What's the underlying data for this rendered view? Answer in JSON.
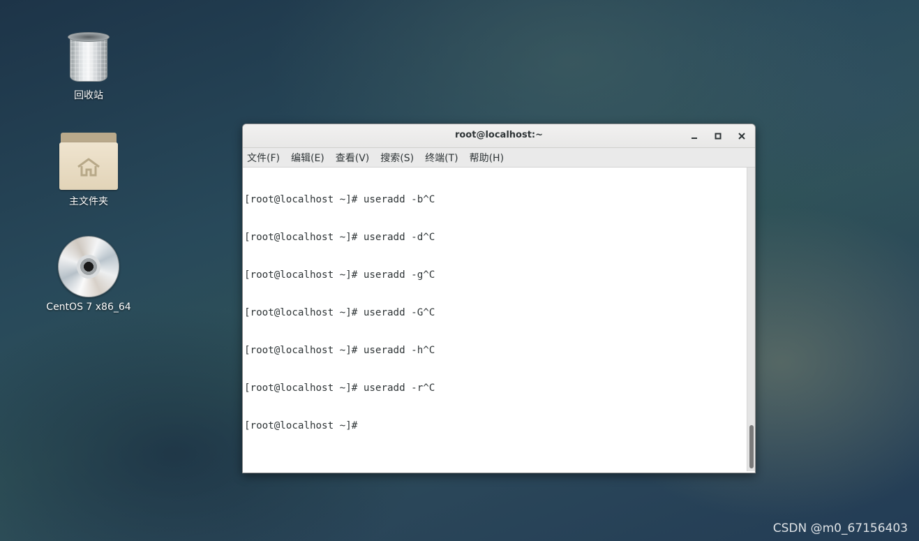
{
  "desktop": {
    "icons": [
      {
        "label": "回收站",
        "icon": "trash-icon"
      },
      {
        "label": "主文件夹",
        "icon": "home-folder-icon"
      },
      {
        "label": "CentOS 7 x86_64",
        "icon": "disc-icon"
      }
    ]
  },
  "terminal": {
    "title": "root@localhost:~",
    "window_buttons": {
      "minimize": "‗",
      "maximize": "□",
      "close": "✕"
    },
    "menu": [
      "文件(F)",
      "编辑(E)",
      "查看(V)",
      "搜索(S)",
      "终端(T)",
      "帮助(H)"
    ],
    "lines": [
      "[root@localhost ~]# useradd -b^C",
      "[root@localhost ~]# useradd -d^C",
      "[root@localhost ~]# useradd -g^C",
      "[root@localhost ~]# useradd -G^C",
      "[root@localhost ~]# useradd -h^C",
      "[root@localhost ~]# useradd -r^C",
      "[root@localhost ~]#"
    ],
    "scroll_position": 1.0
  },
  "watermark": "CSDN @m0_67156403",
  "colors": {
    "desktop_bg": "#28495a",
    "terminal_bg": "#ffffff",
    "terminal_text": "#2e3436"
  }
}
